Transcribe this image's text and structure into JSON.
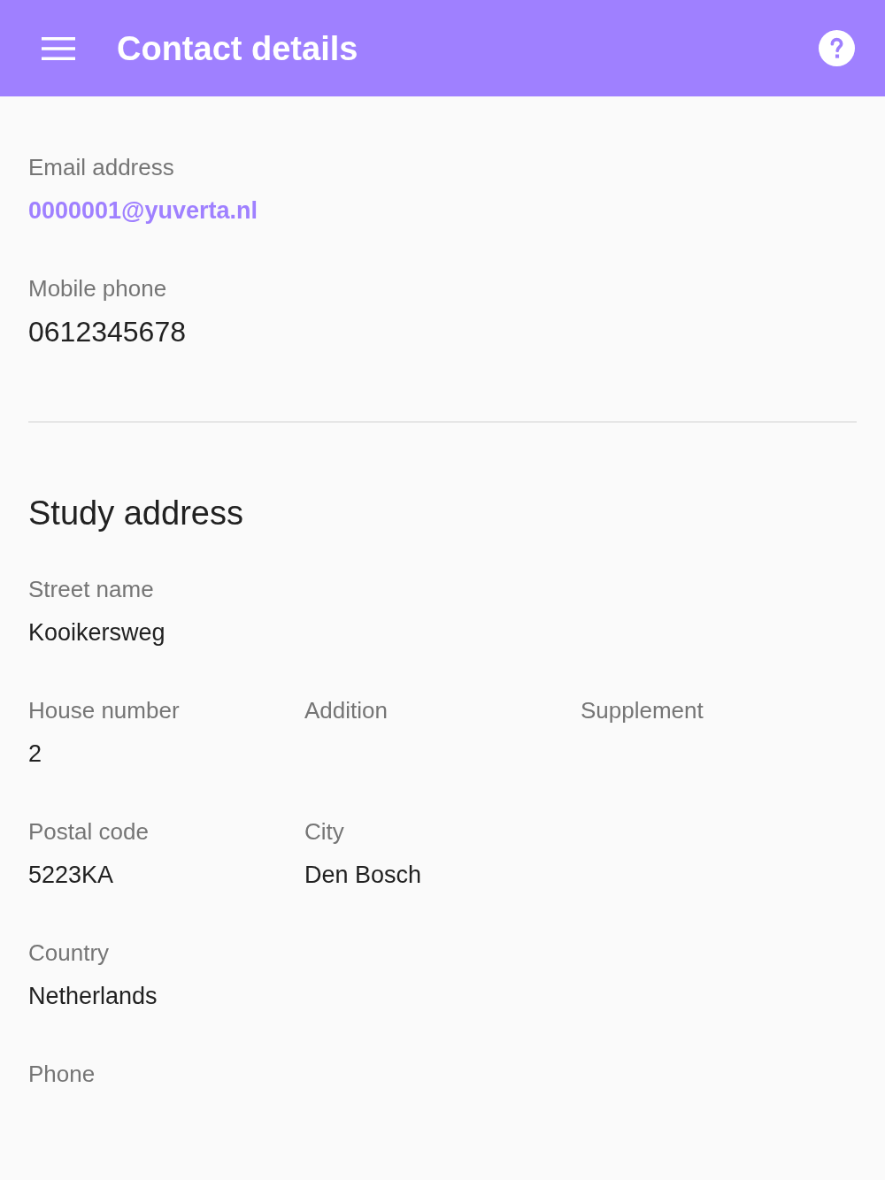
{
  "app_bar": {
    "title": "Contact details"
  },
  "contact": [
    {
      "kind": "link",
      "label": "Email address",
      "value": "0000001@yuverta.nl"
    },
    {
      "kind": "large",
      "label": "Mobile phone",
      "value": "0612345678"
    }
  ],
  "study_address": {
    "title": "Study address",
    "rows": [
      [
        {
          "label": "Street name",
          "value": "Kooikersweg"
        }
      ],
      [
        {
          "label": "House number",
          "value": "2"
        },
        {
          "label": "Addition"
        },
        {
          "label": "Supplement"
        }
      ],
      [
        {
          "label": "Postal code",
          "value": "5223KA"
        },
        {
          "label": "City",
          "value": "Den Bosch"
        }
      ],
      [
        {
          "label": "Country",
          "value": "Netherlands"
        }
      ],
      [
        {
          "label": "Phone"
        }
      ]
    ]
  }
}
